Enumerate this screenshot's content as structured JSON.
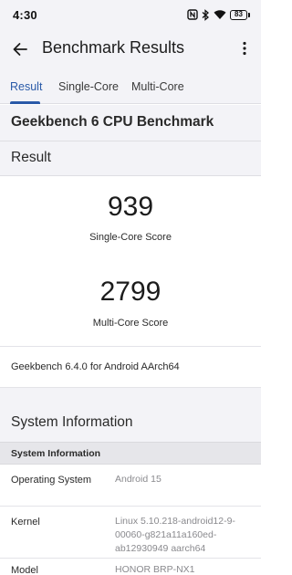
{
  "status_bar": {
    "time": "4:30",
    "battery": "83",
    "icons": [
      "nfc-icon",
      "bluetooth-icon",
      "wifi-icon",
      "battery-icon"
    ]
  },
  "app_bar": {
    "title": "Benchmark Results",
    "back_icon": "arrow-left-icon",
    "menu_icon": "more-vertical-icon"
  },
  "tabs": [
    {
      "label": "Result",
      "active": true
    },
    {
      "label": "Single-Core",
      "active": false
    },
    {
      "label": "Multi-Core",
      "active": false
    }
  ],
  "benchmark": {
    "title": "Geekbench 6 CPU Benchmark",
    "result_heading": "Result",
    "single_core_score": "939",
    "single_core_label": "Single-Core Score",
    "multi_core_score": "2799",
    "multi_core_label": "Multi-Core Score",
    "version": "Geekbench 6.4.0 for Android AArch64"
  },
  "system_information": {
    "heading": "System Information",
    "table_header": "System Information",
    "rows": [
      {
        "key": "Operating System",
        "value": "Android 15"
      },
      {
        "key": "Kernel",
        "value": "Linux 5.10.218-android12-9-00060-g821a11a160ed-ab12930949 aarch64"
      },
      {
        "key": "Model",
        "value": "HONOR BRP-NX1"
      }
    ]
  },
  "colors": {
    "accent": "#2a5aa8",
    "surface": "#f3f3f7",
    "value_text": "#8a8a8e"
  }
}
